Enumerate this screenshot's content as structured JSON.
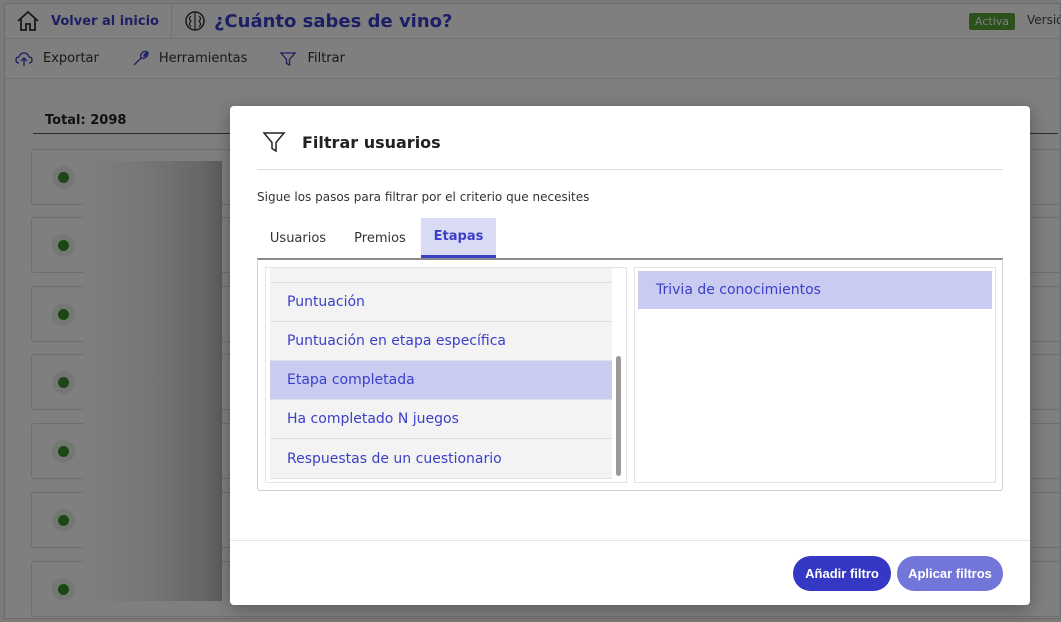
{
  "header": {
    "back_label": "Volver al inicio",
    "title": "¿Cuánto sabes de vino?",
    "status": "Activa",
    "version": "Versió"
  },
  "toolbar": {
    "export_label": "Exportar",
    "tools_label": "Herramientas",
    "filter_label": "Filtrar"
  },
  "content": {
    "total_label": "Total: 2098"
  },
  "modal": {
    "title": "Filtrar usuarios",
    "subtitle": "Sigue los pasos para filtrar por el criterio que necesites",
    "tabs": [
      "Usuarios",
      "Premios",
      "Etapas"
    ],
    "active_tab": "Etapas",
    "left_options": [
      "Puntuación",
      "Puntuación en etapa específica",
      "Etapa completada",
      "Ha completado N juegos",
      "Respuestas de un cuestionario"
    ],
    "selected_option": "Etapa completada",
    "right_options": [
      "Trivia de conocimientos"
    ],
    "add_button": "Añadir filtro",
    "apply_button": "Aplicar filtros"
  },
  "colors": {
    "accent": "#3a3fc8",
    "selected_bg": "#c9ccf0",
    "status_green": "#5aa33a"
  },
  "icons": [
    "home-icon",
    "brain-icon",
    "cloud-export-icon",
    "wrench-icon",
    "filter-icon"
  ]
}
